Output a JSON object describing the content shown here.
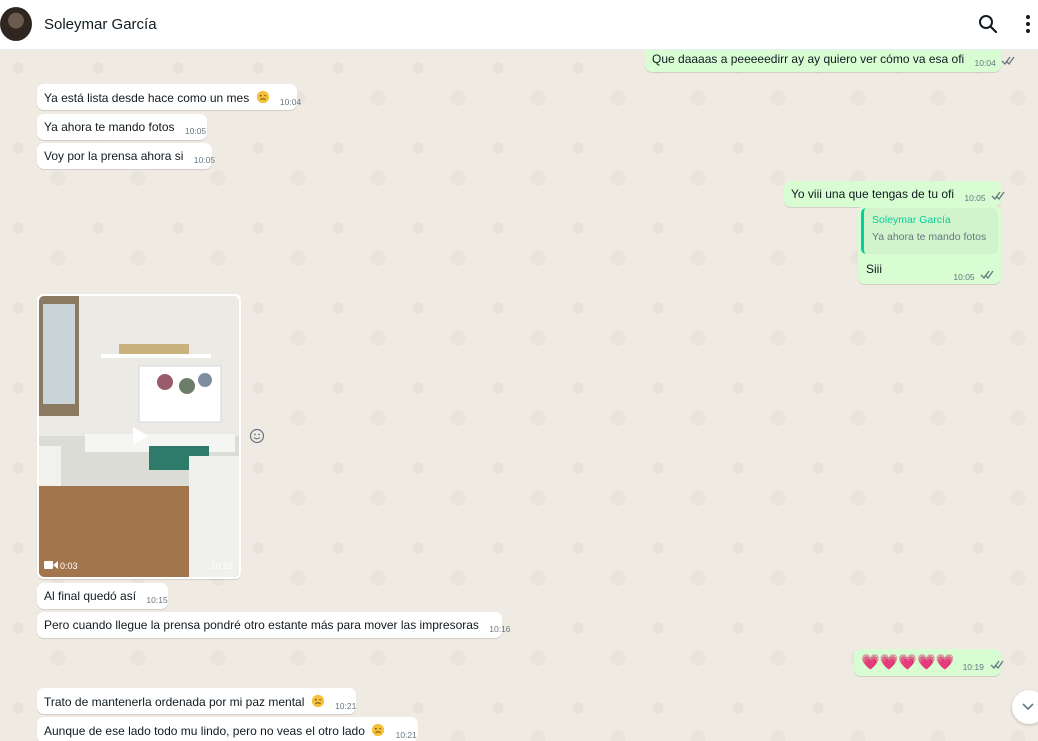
{
  "header": {
    "contact_name": "Soleymar García",
    "avatar_icon": "profile-photo",
    "search_icon": "search-icon",
    "menu_icon": "kebab-menu-icon"
  },
  "colors": {
    "incoming_bubble": "#ffffff",
    "outgoing_bubble": "#d9fdd3",
    "quote_accent": "#06cf9c",
    "read_ticks": "#667781",
    "chat_background": "#efeae2"
  },
  "messages": [
    {
      "id": "m1",
      "direction": "out",
      "text": "Que daaaas a peeeeedirr ay ay quiero ver cómo va esa ofi",
      "time": "10:04",
      "status": "delivered"
    },
    {
      "id": "m2",
      "direction": "in",
      "text": "Ya está lista desde hace como un mes",
      "emoji": "🥴",
      "time": "10:04"
    },
    {
      "id": "m3",
      "direction": "in",
      "text": "Ya ahora te mando fotos",
      "time": "10:05"
    },
    {
      "id": "m4",
      "direction": "in",
      "text": "Voy por la prensa ahora si",
      "time": "10:05"
    },
    {
      "id": "m5",
      "direction": "out",
      "text": "Yo viii una que tengas de tu ofi",
      "time": "10:05",
      "status": "delivered"
    },
    {
      "id": "m6",
      "direction": "out",
      "quote": {
        "author": "Soleymar García",
        "text": "Ya ahora te mando fotos"
      },
      "text": "Siii",
      "time": "10:05",
      "status": "delivered"
    },
    {
      "id": "m7",
      "direction": "in",
      "type": "video",
      "duration": "0:03",
      "time": "10:15"
    },
    {
      "id": "m8",
      "direction": "in",
      "text": "Al final quedó así",
      "time": "10:15"
    },
    {
      "id": "m9",
      "direction": "in",
      "text": "Pero cuando llegue la prensa pondré otro estante más para mover las impresoras",
      "time": "10:16"
    },
    {
      "id": "m10",
      "direction": "out",
      "text": "💗💗💗💗💗",
      "time": "10:19",
      "status": "delivered"
    },
    {
      "id": "m11",
      "direction": "in",
      "text": "Trato de mantenerla ordenada por mi paz mental",
      "emoji": "🥴",
      "time": "10:21"
    },
    {
      "id": "m12",
      "direction": "in",
      "text": "Aunque de ese lado todo mu lindo, pero no veas el otro lado",
      "emoji": "🥴",
      "time": "10:21"
    }
  ]
}
